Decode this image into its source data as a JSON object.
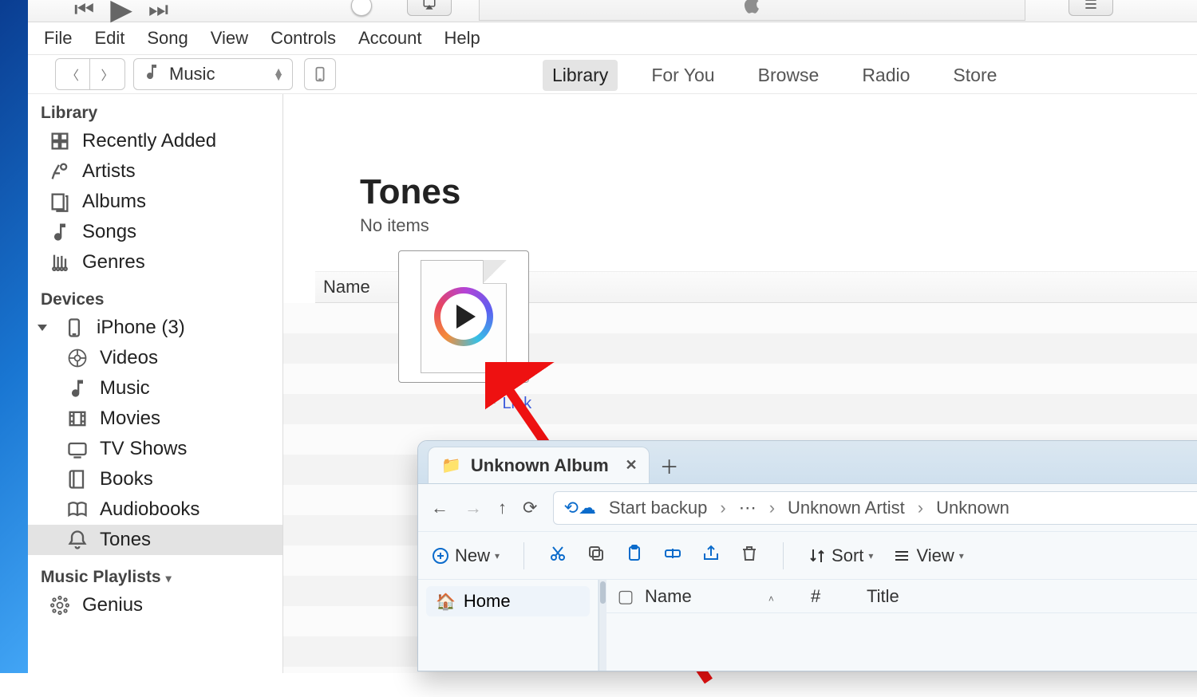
{
  "menu": [
    "File",
    "Edit",
    "Song",
    "View",
    "Controls",
    "Account",
    "Help"
  ],
  "source_selector": "Music",
  "top_nav": {
    "items": [
      "Library",
      "For You",
      "Browse",
      "Radio",
      "Store"
    ],
    "active": "Library"
  },
  "sidebar": {
    "library_header": "Library",
    "library_items": [
      "Recently Added",
      "Artists",
      "Albums",
      "Songs",
      "Genres"
    ],
    "devices_header": "Devices",
    "device_name": "iPhone (3)",
    "device_children": [
      "Videos",
      "Music",
      "Movies",
      "TV Shows",
      "Books",
      "Audiobooks",
      "Tones"
    ],
    "selected": "Tones",
    "playlists_header": "Music Playlists",
    "genius": "Genius"
  },
  "page": {
    "title": "Tones",
    "subtitle": "No items",
    "column_name": "Name",
    "drag_link_label": "Link"
  },
  "explorer": {
    "tab_title": "Unknown Album",
    "breadcrumb": {
      "backup": "Start backup",
      "parts": [
        "Unknown Artist",
        "Unknown"
      ]
    },
    "ribbon": {
      "new": "New",
      "sort": "Sort",
      "view": "View"
    },
    "side_home": "Home",
    "columns": [
      "Name",
      "#",
      "Title"
    ]
  }
}
